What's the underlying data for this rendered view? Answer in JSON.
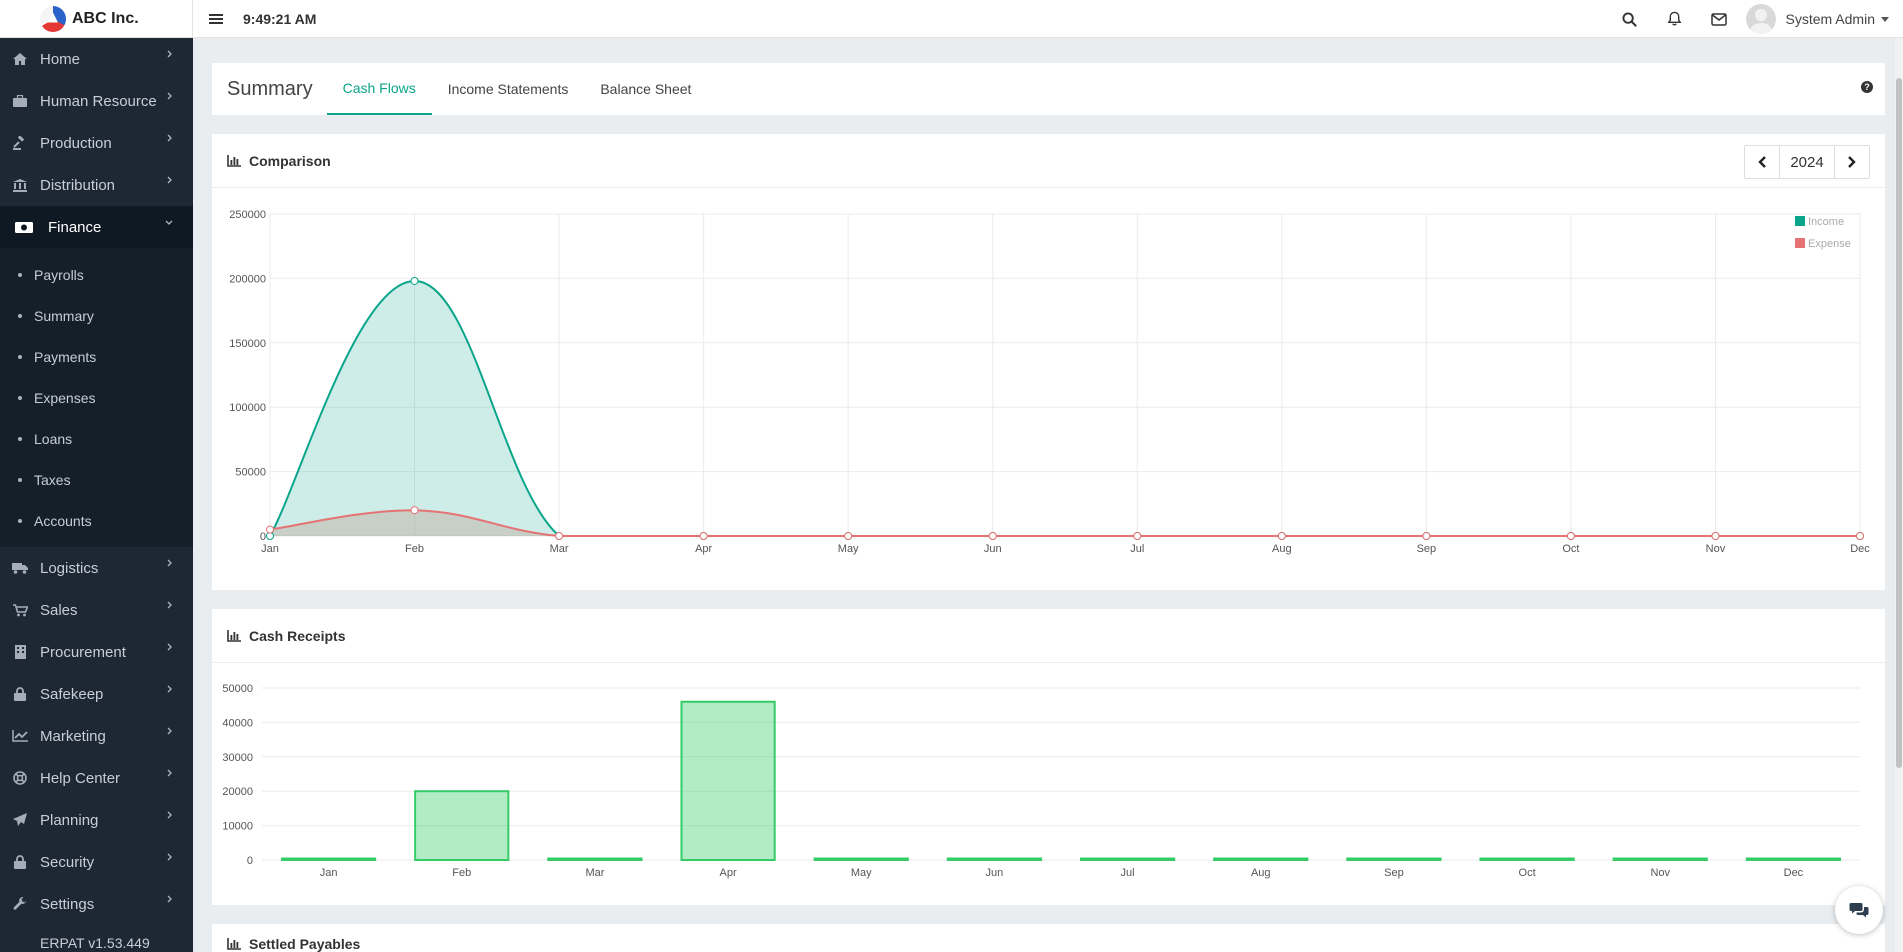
{
  "brand": {
    "name": "ABC Inc."
  },
  "topbar": {
    "time": "9:49:21 AM",
    "user": "System Admin"
  },
  "sidebar": {
    "items": [
      {
        "label": "Home",
        "icon": "home-icon"
      },
      {
        "label": "Human Resource",
        "icon": "briefcase-icon"
      },
      {
        "label": "Production",
        "icon": "gavel-icon"
      },
      {
        "label": "Distribution",
        "icon": "bank-icon"
      },
      {
        "label": "Finance",
        "icon": "money-icon",
        "active": true
      },
      {
        "label": "Logistics",
        "icon": "truck-icon"
      },
      {
        "label": "Sales",
        "icon": "cart-icon"
      },
      {
        "label": "Procurement",
        "icon": "building-icon"
      },
      {
        "label": "Safekeep",
        "icon": "lock-icon"
      },
      {
        "label": "Marketing",
        "icon": "chart-line-icon"
      },
      {
        "label": "Help Center",
        "icon": "lifebuoy-icon"
      },
      {
        "label": "Planning",
        "icon": "paper-plane-icon"
      },
      {
        "label": "Security",
        "icon": "padlock-icon"
      },
      {
        "label": "Settings",
        "icon": "wrench-icon"
      }
    ],
    "finance_submenu": [
      "Payrolls",
      "Summary",
      "Payments",
      "Expenses",
      "Loans",
      "Taxes",
      "Accounts"
    ],
    "version": "ERPAT v1.53.449"
  },
  "page": {
    "title": "Summary",
    "tabs": [
      "Cash Flows",
      "Income Statements",
      "Balance Sheet"
    ],
    "active_tab": "Cash Flows"
  },
  "comparison": {
    "title": "Comparison",
    "year": "2024"
  },
  "receipts": {
    "title": "Cash Receipts"
  },
  "settled": {
    "title": "Settled Payables"
  },
  "colors": {
    "income": "#0aa58a",
    "expense": "#e57373",
    "receipts": "#33cc66",
    "sidebar": "#1d2834"
  },
  "chart_data": [
    {
      "type": "area",
      "categories": [
        "Jan",
        "Feb",
        "Mar",
        "Apr",
        "May",
        "Jun",
        "Jul",
        "Aug",
        "Sep",
        "Oct",
        "Nov",
        "Dec"
      ],
      "series": [
        {
          "name": "Income",
          "values": [
            0,
            198000,
            0,
            0,
            0,
            0,
            0,
            0,
            0,
            0,
            0,
            0
          ]
        },
        {
          "name": "Expense",
          "values": [
            5000,
            20000,
            0,
            0,
            0,
            0,
            0,
            0,
            0,
            0,
            0,
            0
          ]
        }
      ],
      "ylim": [
        0,
        250000
      ],
      "yticks": [
        0,
        50000,
        100000,
        150000,
        200000,
        250000
      ],
      "grid": true,
      "legend": "top-right"
    },
    {
      "type": "bar",
      "categories": [
        "Jan",
        "Feb",
        "Mar",
        "Apr",
        "May",
        "Jun",
        "Jul",
        "Aug",
        "Sep",
        "Oct",
        "Nov",
        "Dec"
      ],
      "values": [
        0,
        20000,
        0,
        46000,
        0,
        0,
        0,
        0,
        0,
        0,
        0,
        0
      ],
      "ylim": [
        0,
        50000
      ],
      "yticks": [
        0,
        10000,
        20000,
        30000,
        40000,
        50000
      ],
      "grid": true
    }
  ]
}
